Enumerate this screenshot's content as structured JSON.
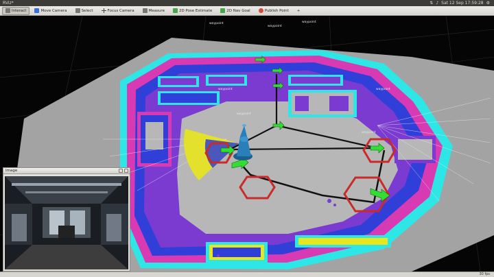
{
  "window": {
    "title": "RViz*"
  },
  "system_tray": {
    "datetime": "Sat 12 Sep 17:59:28"
  },
  "toolbar": {
    "interact": "Interact",
    "move_camera": "Move Camera",
    "select": "Select",
    "focus_camera": "Focus Camera",
    "measure": "Measure",
    "pose_estimate": "2D Pose Estimate",
    "nav_goal": "2D Nav Goal",
    "publish_point": "Publish Point"
  },
  "viewport": {
    "frame_labels": [
      "waypoint",
      "waypoint",
      "waypoint",
      "waypoint",
      "waypoint",
      "waypoint",
      "waypoint"
    ]
  },
  "image_panel": {
    "title": "Image"
  },
  "status": {
    "fps": "30 fps"
  },
  "colors": {
    "free_space": "#b7b7b7",
    "inflation_purple": "#7b3bd1",
    "inflation_blue": "#2f3fd8",
    "lethal_cyan": "#2ee6e6",
    "lethal_magenta": "#d83ab4",
    "goal_marker": "#33dd33",
    "robot": "#2a7fb8",
    "path": "#111111",
    "waypoint_circle": "#c92a2a"
  }
}
